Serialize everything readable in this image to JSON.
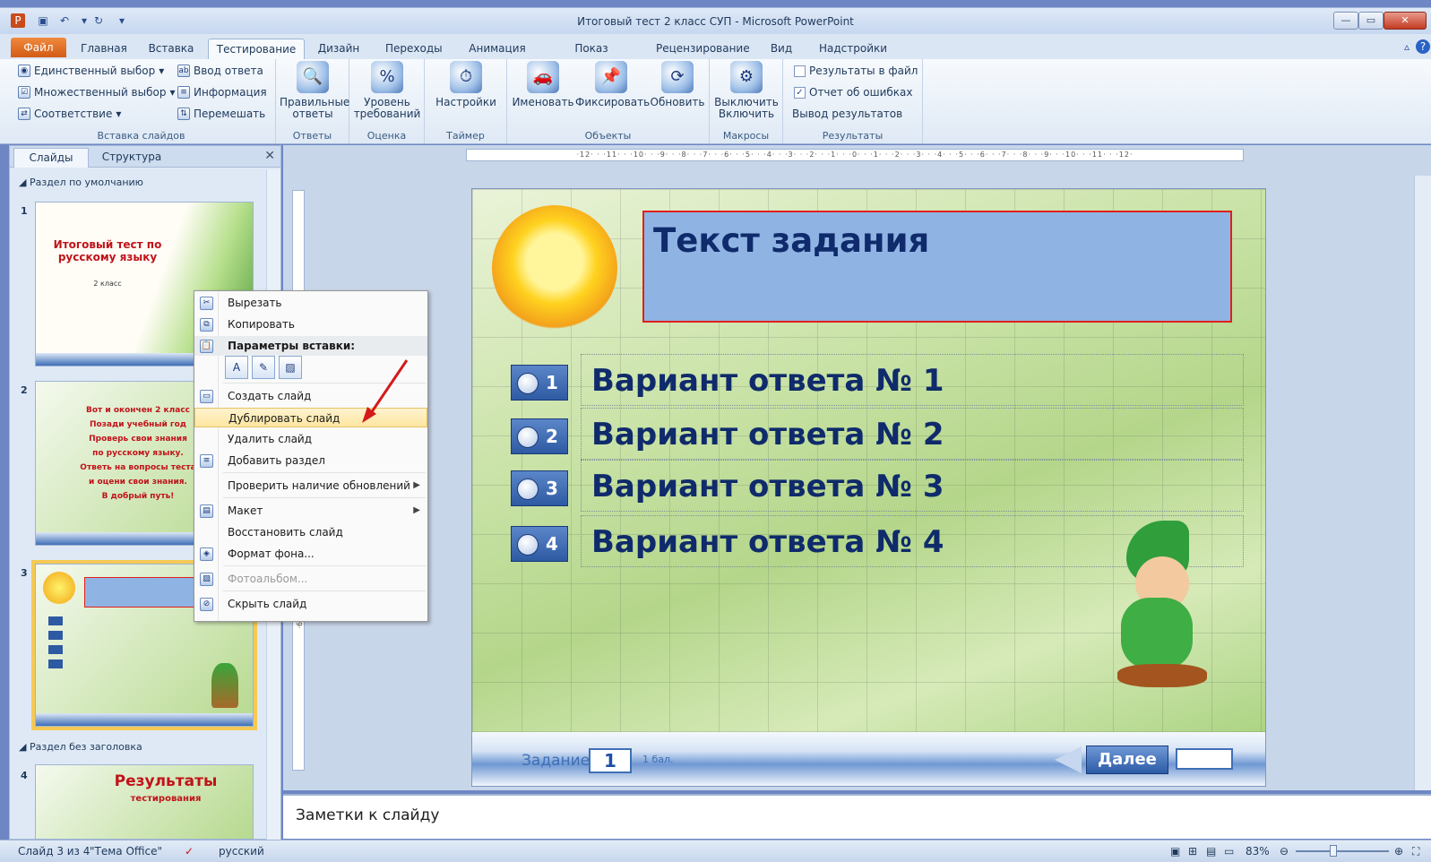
{
  "window": {
    "title": "Итоговый тест 2 класс СУП - Microsoft PowerPoint"
  },
  "tabs": [
    "Главная",
    "Вставка",
    "Тестирование",
    "Дизайн",
    "Переходы",
    "Анимация",
    "Показ слайдов",
    "Рецензирование",
    "Вид",
    "Надстройки"
  ],
  "file_tab": "Файл",
  "ribbon": {
    "insert_group": {
      "label": "Вставка слайдов",
      "items": [
        "Единственный выбор",
        "Множественный выбор",
        "Соответствие",
        "Ввод ответа",
        "Информация",
        "Перемешать"
      ]
    },
    "answers": {
      "label": "Ответы",
      "button": "Правильные ответы"
    },
    "grading": {
      "label": "Оценка",
      "button": "Уровень требований"
    },
    "timer": {
      "label": "Таймер",
      "button": "Настройки"
    },
    "objects": {
      "label": "Объекты",
      "buttons": [
        "Именовать",
        "Фиксировать",
        "Обновить"
      ]
    },
    "macros": {
      "label": "Макросы",
      "button": "Выключить Включить"
    },
    "results": {
      "label": "Результаты",
      "items": [
        "Результаты в файл",
        "Отчет об ошибках",
        "Вывод результатов"
      ],
      "checked": [
        false,
        true
      ]
    }
  },
  "left_pane": {
    "tabs": [
      "Слайды",
      "Структура"
    ],
    "section1": "Раздел по умолчанию",
    "section2": "Раздел без заголовка",
    "thumb1": {
      "num": "1",
      "title": "Итоговый тест по русскому языку",
      "sub": "2 класс"
    },
    "thumb2": {
      "num": "2",
      "lines": [
        "Вот и окончен 2 класс",
        "Позади учебный год",
        "Проверь свои знания",
        "по русскому языку.",
        "Ответь на вопросы теста",
        "и оцени свои знания.",
        "В добрый путь!"
      ]
    },
    "thumb3": {
      "num": "3"
    },
    "thumb4": {
      "num": "4",
      "title": "Результаты",
      "sub": "тестирования"
    }
  },
  "context_menu": {
    "items": [
      "Вырезать",
      "Копировать",
      "Параметры вставки:",
      "Создать слайд",
      "Дублировать слайд",
      "Удалить слайд",
      "Добавить раздел",
      "Проверить наличие обновлений",
      "Макет",
      "Восстановить слайд",
      "Формат фона...",
      "Фотоальбом...",
      "Скрыть слайд"
    ],
    "highlighted": "Дублировать слайд"
  },
  "slide": {
    "task_text": "Текст задания",
    "answers": [
      {
        "num": "1",
        "text": "Вариант ответа № 1"
      },
      {
        "num": "2",
        "text": "Вариант ответа № 2"
      },
      {
        "num": "3",
        "text": "Вариант ответа № 3"
      },
      {
        "num": "4",
        "text": "Вариант ответа № 4"
      }
    ],
    "footer": {
      "label": "Задание",
      "number": "1",
      "points": "1 бал.",
      "next": "Далее"
    }
  },
  "notes": {
    "placeholder": "Заметки к слайду"
  },
  "status": {
    "slide": "Слайд 3 из 4",
    "theme": "\"Тема Office\"",
    "lang": "русский",
    "zoom": "83%"
  },
  "colors": {
    "accent": "#3f6fb6",
    "file_tab": "#e06a20",
    "task_border": "#e0201c",
    "highlight": "#fde6a0"
  }
}
